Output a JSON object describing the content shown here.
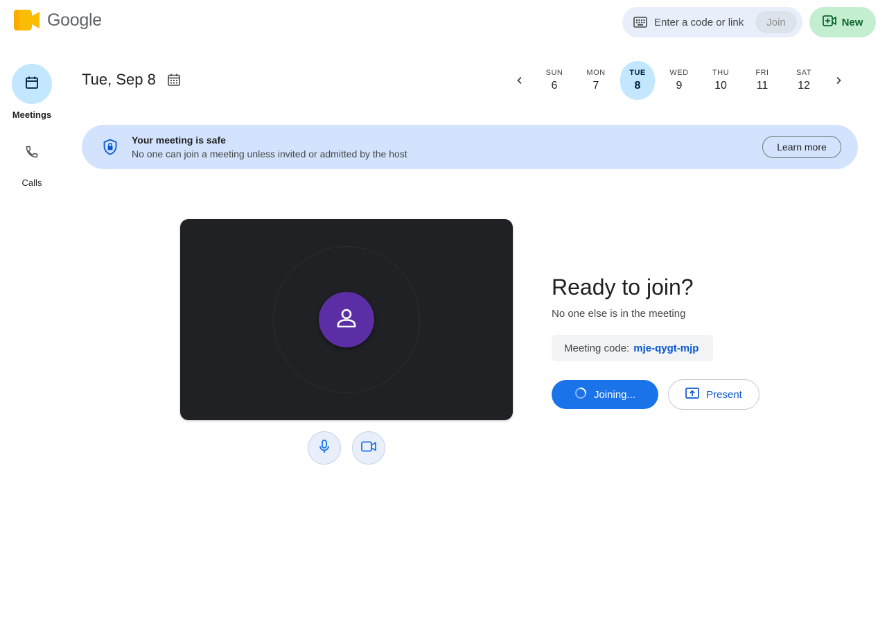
{
  "header": {
    "brand": "Google",
    "join_placeholder": "Enter a code or link",
    "join_label": "Join",
    "new_label": "New"
  },
  "rail": {
    "items": [
      {
        "label": "Meetings",
        "icon": "calendar-icon",
        "active": true
      },
      {
        "label": "Calls",
        "icon": "phone-icon",
        "active": false
      }
    ]
  },
  "date": {
    "title": "Tue, Sep 8"
  },
  "week": [
    {
      "name": "SUN",
      "num": "6"
    },
    {
      "name": "MON",
      "num": "7"
    },
    {
      "name": "TUE",
      "num": "8",
      "active": true
    },
    {
      "name": "WED",
      "num": "9"
    },
    {
      "name": "THU",
      "num": "10"
    },
    {
      "name": "FRI",
      "num": "11"
    },
    {
      "name": "SAT",
      "num": "12"
    }
  ],
  "banner": {
    "title": "Your meeting is safe",
    "subtitle": "No one can join a meeting unless invited or admitted by the host",
    "button": "Learn more"
  },
  "join_panel": {
    "title": "Ready to join?",
    "subtitle": "No one else is in the meeting",
    "code_label": "Meeting code:",
    "code_value": "mje-qygt-mjp",
    "joining_label": "Joining...",
    "present_label": "Present"
  },
  "colors": {
    "accent": "#1a73e8",
    "banner_bg": "#d3e3fd",
    "active_day": "#c2e7ff",
    "new_button_bg": "#c4eed0",
    "avatar": "#5b2ea6"
  }
}
